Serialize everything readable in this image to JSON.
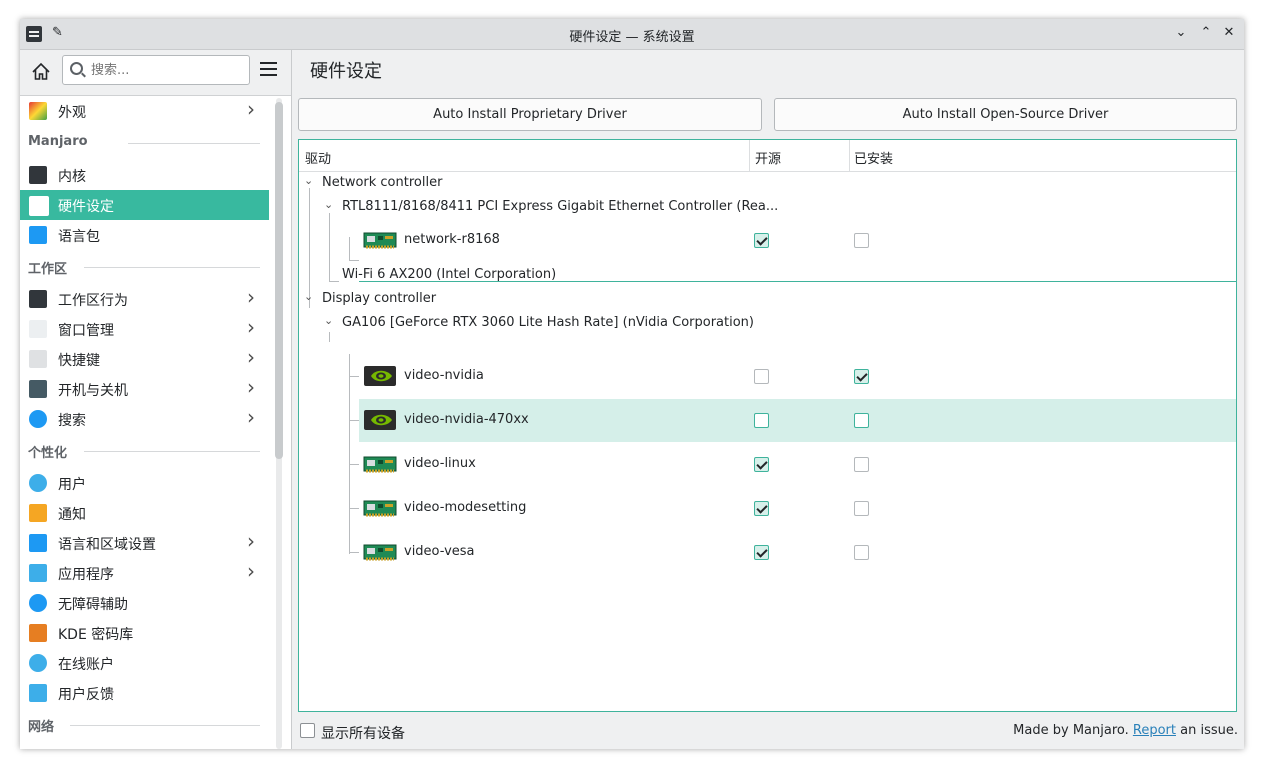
{
  "window": {
    "title": "硬件设定 — 系统设置",
    "buttons": {
      "minimize": "⌄",
      "maximize": "⌃",
      "close": "✕"
    }
  },
  "sidebar": {
    "search_placeholder": "搜索...",
    "items": [
      {
        "label": "外观",
        "icon": "appearance-icon",
        "chevron": true
      },
      {
        "header": "Manjaro"
      },
      {
        "label": "内核",
        "icon": "kernel-icon",
        "chevron": false
      },
      {
        "label": "硬件设定",
        "icon": "hardware-icon",
        "chevron": false,
        "selected": true
      },
      {
        "label": "语言包",
        "icon": "language-pack-icon",
        "chevron": false
      },
      {
        "header": "工作区"
      },
      {
        "label": "工作区行为",
        "icon": "workspace-behavior-icon",
        "chevron": true
      },
      {
        "label": "窗口管理",
        "icon": "window-management-icon",
        "chevron": true
      },
      {
        "label": "快捷键",
        "icon": "keyboard-icon",
        "chevron": true
      },
      {
        "label": "开机与关机",
        "icon": "startup-shutdown-icon",
        "chevron": true
      },
      {
        "label": "搜索",
        "icon": "search-icon",
        "chevron": true
      },
      {
        "header": "个性化"
      },
      {
        "label": "用户",
        "icon": "users-icon",
        "chevron": false
      },
      {
        "label": "通知",
        "icon": "bell-icon",
        "chevron": false
      },
      {
        "label": "语言和区域设置",
        "icon": "region-icon",
        "chevron": true
      },
      {
        "label": "应用程序",
        "icon": "applications-icon",
        "chevron": true
      },
      {
        "label": "无障碍辅助",
        "icon": "accessibility-icon",
        "chevron": false
      },
      {
        "label": "KDE 密码库",
        "icon": "wallet-icon",
        "chevron": false
      },
      {
        "label": "在线账户",
        "icon": "online-accounts-icon",
        "chevron": false
      },
      {
        "label": "用户反馈",
        "icon": "feedback-icon",
        "chevron": false
      },
      {
        "header": "网络"
      }
    ]
  },
  "main": {
    "title": "硬件设定",
    "btn_proprietary": "Auto Install Proprietary Driver",
    "btn_opensource": "Auto Install Open-Source Driver",
    "columns": {
      "driver": "驱动",
      "open_source": "开源",
      "installed": "已安装"
    },
    "tree": {
      "network_controller": "Network controller",
      "rtl_device": "RTL8111/8168/8411 PCI Express Gigabit Ethernet Controller (Rea...",
      "wifi_device": "Wi-Fi 6 AX200 (Intel Corporation)",
      "display_controller": "Display controller",
      "gpu_device": "GA106 [GeForce RTX 3060 Lite Hash Rate] (nVidia Corporation)"
    },
    "drivers": [
      {
        "name": "network-r8168",
        "icon": "network-card-icon",
        "open_source": true,
        "installed": false
      },
      {
        "name": "video-nvidia",
        "icon": "nvidia-icon",
        "open_source": false,
        "installed": true
      },
      {
        "name": "video-nvidia-470xx",
        "icon": "nvidia-icon",
        "open_source": false,
        "installed": false
      },
      {
        "name": "video-linux",
        "icon": "video-card-icon",
        "open_source": true,
        "installed": false
      },
      {
        "name": "video-modesetting",
        "icon": "video-card-icon",
        "open_source": true,
        "installed": false
      },
      {
        "name": "video-vesa",
        "icon": "video-card-icon",
        "open_source": true,
        "installed": false
      }
    ]
  },
  "footer": {
    "show_all_label": "显示所有设备",
    "made_by": "Made by Manjaro.",
    "report_link": "Report",
    "issue_text": "an issue."
  }
}
